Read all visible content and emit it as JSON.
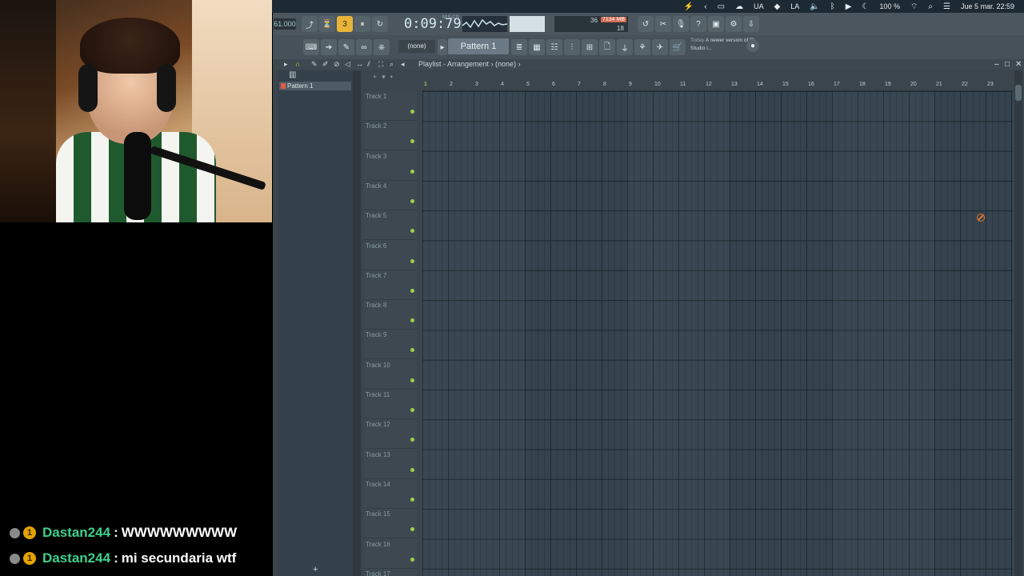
{
  "stream": {
    "chat": [
      {
        "user": "Dastan244",
        "message": "WWWWWWWWW"
      },
      {
        "user": "Dastan244",
        "message": "mi secundaria wtf"
      }
    ],
    "sub_badge_number": "1",
    "separator": ":"
  },
  "menubar": {
    "keyboard_layout": "UA",
    "input_source": "LA",
    "battery": "100 %",
    "datetime": "Jue 5 mar.  22:59"
  },
  "fl": {
    "tempo": "61.000",
    "time": "0:09:79",
    "time_unit_label": "M:S:CS",
    "cpu_value": "36",
    "memory": "7134 MB",
    "polyphony": "18",
    "pattern_selector": "(none)",
    "pattern_name": "Pattern 1",
    "news_prefix": "Today",
    "news_text": "A newer version of FL Studio i..."
  },
  "playlist": {
    "title": "Playlist - Arrangement",
    "arrangement": "(none)",
    "picker_items": [
      "Pattern 1"
    ],
    "ruler": [
      "1",
      "2",
      "3",
      "4",
      "5",
      "6",
      "7",
      "8",
      "9",
      "10",
      "11",
      "12",
      "13",
      "14",
      "15",
      "16",
      "17",
      "18",
      "19",
      "20",
      "21",
      "22",
      "23"
    ],
    "tracks": [
      "Track 1",
      "Track 2",
      "Track 3",
      "Track 4",
      "Track 5",
      "Track 6",
      "Track 7",
      "Track 8",
      "Track 9",
      "Track 10",
      "Track 11",
      "Track 12",
      "Track 13",
      "Track 14",
      "Track 15",
      "Track 16",
      "Track 17"
    ],
    "add_label": "+"
  },
  "colors": {
    "chat_username": "#3fcf8e",
    "time_display": "#d5e9f2",
    "track_led": "#9dd048",
    "active_toolbar_button": "#e8b53a"
  }
}
